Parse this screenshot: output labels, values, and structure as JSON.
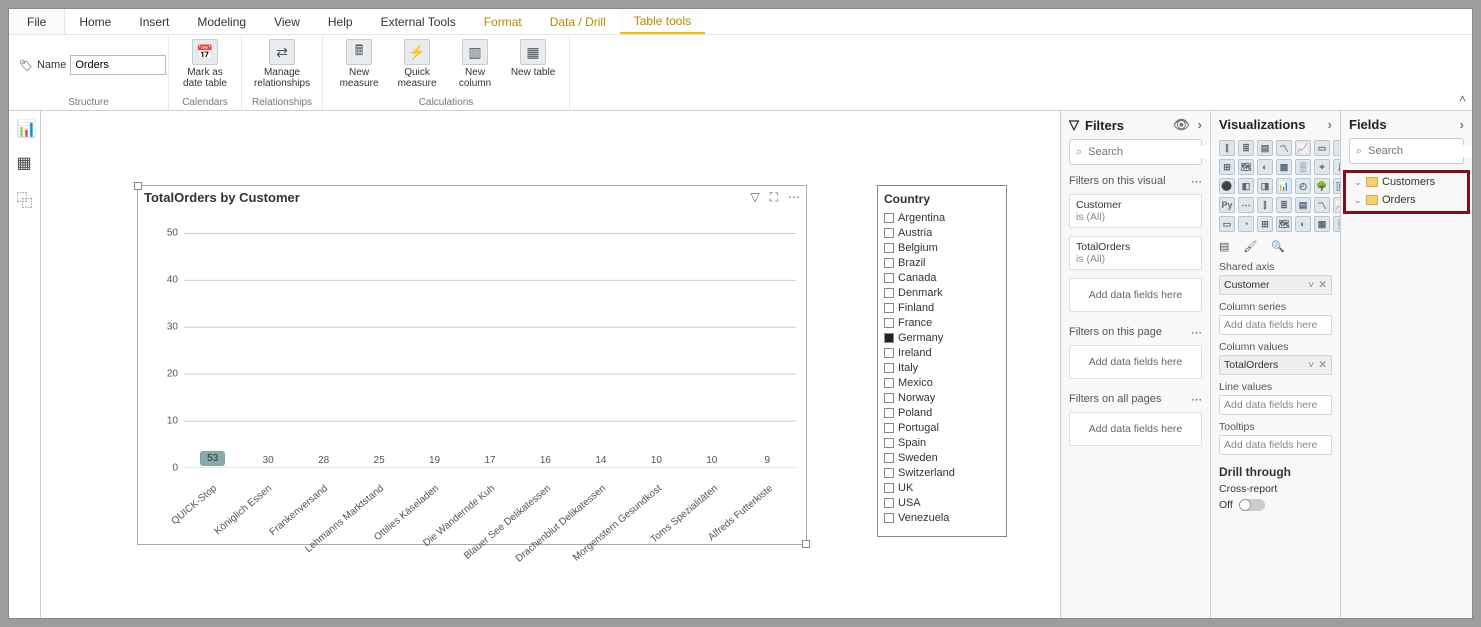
{
  "tabs": {
    "file": "File",
    "items": [
      "Home",
      "Insert",
      "Modeling",
      "View",
      "Help",
      "External Tools",
      "Format",
      "Data / Drill",
      "Table tools"
    ],
    "gold_from_index": 6,
    "active_index": 8
  },
  "ribbon": {
    "name_label": "Name",
    "name_value": "Orders",
    "groups": {
      "structure": "Structure",
      "calendars": "Calendars",
      "relationships": "Relationships",
      "calculations": "Calculations"
    },
    "buttons": {
      "mark_date": "Mark as date table",
      "manage_rel": "Manage relationships",
      "new_measure": "New measure",
      "quick_measure": "Quick measure",
      "new_column": "New column",
      "new_table": "New table"
    }
  },
  "chart_data": {
    "type": "bar",
    "title": "TotalOrders by Customer",
    "ylim": [
      0,
      55
    ],
    "yticks": [
      0,
      10,
      20,
      30,
      40,
      50
    ],
    "categories": [
      "QUICK-Stop",
      "Königlich Essen",
      "Frankenversand",
      "Lehmanns Marktstand",
      "Ottilies Käseladen",
      "Die Wandernde Kuh",
      "Blauer See Delikatessen",
      "Drachenblut Delikatessen",
      "Morgenstern Gesundkost",
      "Toms Spezialitäten",
      "Alfreds Futterkiste"
    ],
    "values": [
      53,
      30,
      28,
      25,
      19,
      17,
      16,
      14,
      10,
      10,
      9
    ],
    "highlight_index": 0
  },
  "slicer": {
    "title": "Country",
    "items": [
      "Argentina",
      "Austria",
      "Belgium",
      "Brazil",
      "Canada",
      "Denmark",
      "Finland",
      "France",
      "Germany",
      "Ireland",
      "Italy",
      "Mexico",
      "Norway",
      "Poland",
      "Portugal",
      "Spain",
      "Sweden",
      "Switzerland",
      "UK",
      "USA",
      "Venezuela"
    ],
    "selected": "Germany"
  },
  "filters": {
    "title": "Filters",
    "search_placeholder": "Search",
    "sections": {
      "visual": "Filters on this visual",
      "page": "Filters on this page",
      "all": "Filters on all pages"
    },
    "cards": {
      "customer": {
        "name": "Customer",
        "state": "is (All)"
      },
      "totalorders": {
        "name": "TotalOrders",
        "state": "is (All)"
      }
    },
    "add": "Add data fields here"
  },
  "viz": {
    "title": "Visualizations",
    "shared_axis": "Shared axis",
    "column_series": "Column series",
    "column_values": "Column values",
    "line_values": "Line values",
    "tooltips": "Tooltips",
    "drill": "Drill through",
    "cross": "Cross-report",
    "off": "Off",
    "add": "Add data fields here",
    "wells": {
      "shared_axis_value": "Customer",
      "column_values_value": "TotalOrders"
    }
  },
  "fields": {
    "title": "Fields",
    "search_placeholder": "Search",
    "tables": [
      "Customers",
      "Orders"
    ]
  }
}
